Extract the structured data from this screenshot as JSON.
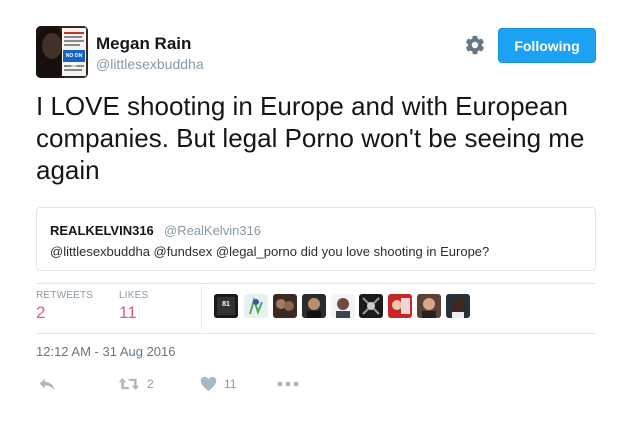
{
  "author": {
    "display_name": "Megan Rain",
    "screen_name": "@littlesexbuddha",
    "avatar_badge_text": "NO ON 60"
  },
  "follow_button": {
    "label": "Following"
  },
  "tweet": {
    "text": "I LOVE shooting in Europe and with European companies. But legal Porno won't be seeing me again"
  },
  "quoted_tweet": {
    "display_name": "REALKELVIN316",
    "screen_name": "@RealKelvin316",
    "text": "@littlesexbuddha @fundsex @legal_porno did you love shooting in Europe?"
  },
  "stats": {
    "retweets_label": "RETWEETS",
    "retweets_value": "2",
    "likes_label": "LIKES",
    "likes_value": "11",
    "likers": [
      {
        "badge": "81"
      },
      {},
      {},
      {},
      {},
      {},
      {},
      {},
      {}
    ]
  },
  "timestamp": "12:12 AM - 31 Aug 2016",
  "actions": {
    "retweet_count": "2",
    "like_count": "11"
  },
  "colors": {
    "accent": "#1da1f2",
    "like_red": "#e0245e",
    "muted": "#8899a6",
    "border": "#e1e8ed"
  },
  "icons": [
    "gear-icon",
    "reply-icon",
    "retweet-icon",
    "heart-icon",
    "more-icon"
  ]
}
